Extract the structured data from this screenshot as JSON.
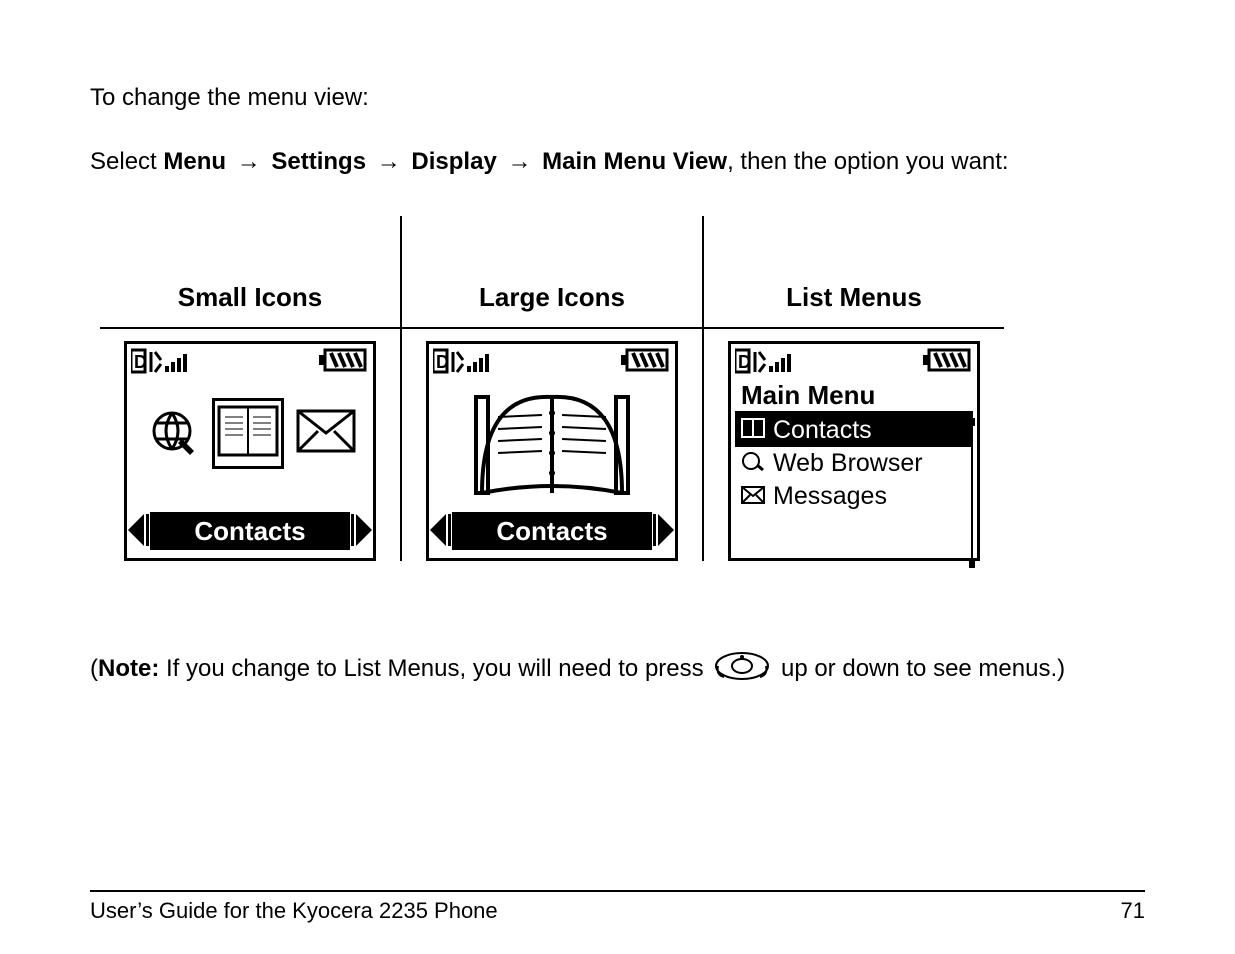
{
  "body": {
    "intro": "To change the menu view:",
    "select_prefix": "Select ",
    "nav_path": [
      "Menu",
      "Settings",
      "Display",
      "Main Menu View"
    ],
    "arrow": "→",
    "select_suffix": ", then the option you want:"
  },
  "columns": {
    "small": {
      "header": "Small Icons",
      "selected_label": "Contacts"
    },
    "large": {
      "header": "Large Icons",
      "selected_label": "Contacts"
    },
    "list": {
      "header": "List Menus",
      "title": "Main Menu",
      "items": [
        {
          "label": "Contacts",
          "icon": "contacts-icon",
          "selected": true
        },
        {
          "label": "Web Browser",
          "icon": "globe-icon",
          "selected": false
        },
        {
          "label": "Messages",
          "icon": "envelope-icon",
          "selected": false
        }
      ]
    }
  },
  "note": {
    "label": "Note:",
    "open_paren": "(",
    "text_before_key": " If you change to List Menus, you will need to press ",
    "text_after_key": " up or down to see menus.)"
  },
  "footer": {
    "left": "User’s Guide for the Kyocera 2235 Phone",
    "right": "71"
  }
}
